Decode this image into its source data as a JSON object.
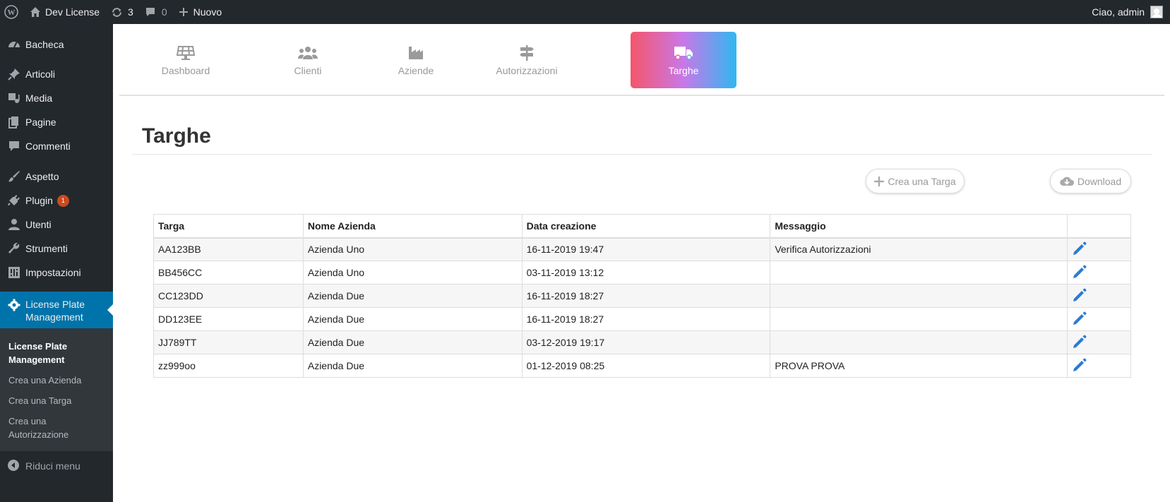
{
  "adminbar": {
    "site_name": "Dev License",
    "updates_count": "3",
    "comments_count": "0",
    "new_label": "Nuovo",
    "greeting": "Ciao, admin"
  },
  "sidebar": {
    "items": [
      {
        "label": "Bacheca",
        "icon": "dashboard-icon"
      },
      {
        "label": "Articoli",
        "icon": "pin-icon"
      },
      {
        "label": "Media",
        "icon": "media-icon"
      },
      {
        "label": "Pagine",
        "icon": "pages-icon"
      },
      {
        "label": "Commenti",
        "icon": "comment-icon"
      },
      {
        "label": "Aspetto",
        "icon": "brush-icon"
      },
      {
        "label": "Plugin",
        "icon": "plugin-icon",
        "badge": "1"
      },
      {
        "label": "Utenti",
        "icon": "user-icon"
      },
      {
        "label": "Strumenti",
        "icon": "wrench-icon"
      },
      {
        "label": "Impostazioni",
        "icon": "settings-icon"
      }
    ],
    "active": {
      "label_line1": "License Plate",
      "label_line2": "Management",
      "icon": "gear-icon"
    },
    "submenu": {
      "current_line1": "License Plate",
      "current_line2": "Management",
      "items": [
        "Crea una Azienda",
        "Crea una Targa"
      ],
      "last_line1": "Crea una",
      "last_line2": "Autorizzazione"
    },
    "collapse_label": "Riduci menu"
  },
  "topnav": {
    "tabs": [
      {
        "label": "Dashboard",
        "icon": "solar-panel-icon"
      },
      {
        "label": "Clienti",
        "icon": "users-icon"
      },
      {
        "label": "Aziende",
        "icon": "industry-icon"
      },
      {
        "label": "Autorizzazioni",
        "icon": "signpost-icon"
      },
      {
        "label": "Targhe",
        "icon": "truck-icon"
      }
    ],
    "active_tab": "Targhe",
    "active_gradient": [
      "#f5566b",
      "#c878e8",
      "#2fb8f0"
    ]
  },
  "page": {
    "title": "Targhe",
    "create_button": "Crea una Targa",
    "download_button": "Download"
  },
  "table": {
    "headers": [
      "Targa",
      "Nome Azienda",
      "Data creazione",
      "Messaggio",
      ""
    ],
    "rows": [
      {
        "targa": "AA123BB",
        "azienda": "Azienda Uno",
        "data": "16-11-2019 19:47",
        "messaggio": "Verifica Autorizzazioni"
      },
      {
        "targa": "BB456CC",
        "azienda": "Azienda Uno",
        "data": "03-11-2019 13:12",
        "messaggio": ""
      },
      {
        "targa": "CC123DD",
        "azienda": "Azienda Due",
        "data": "16-11-2019 18:27",
        "messaggio": ""
      },
      {
        "targa": "DD123EE",
        "azienda": "Azienda Due",
        "data": "16-11-2019 18:27",
        "messaggio": ""
      },
      {
        "targa": "JJ789TT",
        "azienda": "Azienda Due",
        "data": "03-12-2019 19:17",
        "messaggio": ""
      },
      {
        "targa": "zz999oo",
        "azienda": "Azienda Due",
        "data": "01-12-2019 08:25",
        "messaggio": "PROVA PROVA"
      }
    ],
    "edit_color": "#2b7cd3"
  }
}
